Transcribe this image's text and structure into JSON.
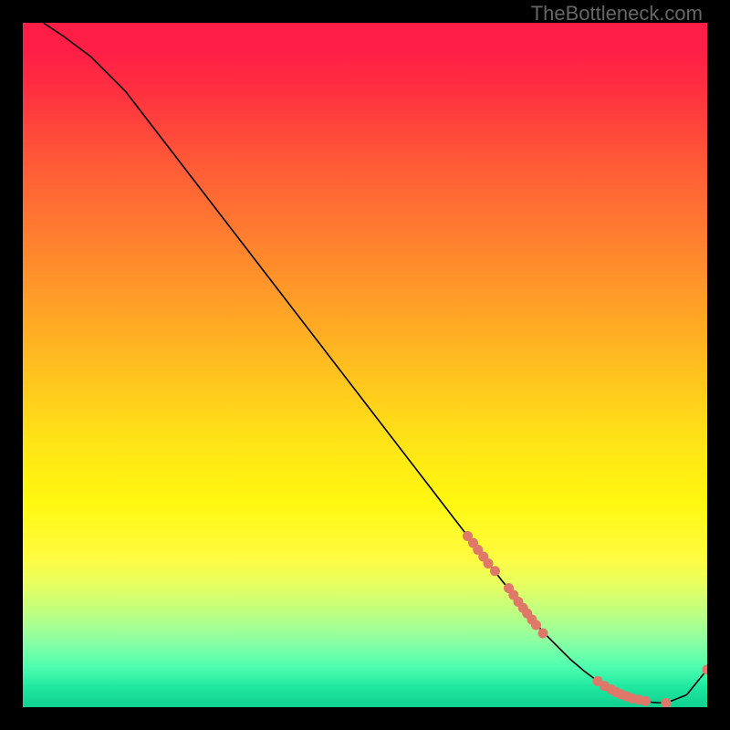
{
  "watermark": "TheBottleneck.com",
  "chart_data": {
    "type": "line",
    "title": "",
    "xlabel": "",
    "ylabel": "",
    "xlim": [
      0,
      100
    ],
    "ylim": [
      0,
      100
    ],
    "series": [
      {
        "name": "bottleneck-curve",
        "x": [
          3,
          6,
          10,
          15,
          20,
          25,
          30,
          35,
          40,
          45,
          50,
          55,
          60,
          65,
          70,
          72,
          74,
          76,
          78,
          80,
          82,
          84,
          86,
          88,
          90,
          92,
          94,
          97,
          100
        ],
        "y": [
          100,
          98,
          95,
          90,
          83.5,
          77,
          70.5,
          64,
          57.5,
          51,
          44.5,
          38,
          31.5,
          25,
          18.5,
          16,
          13.5,
          11,
          9,
          7,
          5.3,
          3.8,
          2.6,
          1.7,
          1.1,
          0.7,
          0.6,
          1.8,
          5.5
        ]
      }
    ],
    "markers": [
      {
        "x": 65.0,
        "y": 25.0
      },
      {
        "x": 65.8,
        "y": 24.0
      },
      {
        "x": 66.5,
        "y": 23.0
      },
      {
        "x": 67.3,
        "y": 22.0
      },
      {
        "x": 68.0,
        "y": 21.0
      },
      {
        "x": 69.0,
        "y": 19.9
      },
      {
        "x": 71.0,
        "y": 17.4
      },
      {
        "x": 71.7,
        "y": 16.4
      },
      {
        "x": 72.4,
        "y": 15.4
      },
      {
        "x": 73.1,
        "y": 14.5
      },
      {
        "x": 73.7,
        "y": 13.7
      },
      {
        "x": 74.4,
        "y": 12.8
      },
      {
        "x": 75.0,
        "y": 12.0
      },
      {
        "x": 76.0,
        "y": 10.8
      },
      {
        "x": 84.0,
        "y": 3.8
      },
      {
        "x": 85.0,
        "y": 3.1
      },
      {
        "x": 86.0,
        "y": 2.6
      },
      {
        "x": 86.7,
        "y": 2.2
      },
      {
        "x": 87.4,
        "y": 1.9
      },
      {
        "x": 88.2,
        "y": 1.6
      },
      {
        "x": 89.0,
        "y": 1.3
      },
      {
        "x": 90.0,
        "y": 1.1
      },
      {
        "x": 91.0,
        "y": 0.9
      },
      {
        "x": 94.0,
        "y": 0.6
      },
      {
        "x": 100.0,
        "y": 5.5
      }
    ],
    "marker_color": "#e0786a",
    "curve_color": "#000000"
  }
}
